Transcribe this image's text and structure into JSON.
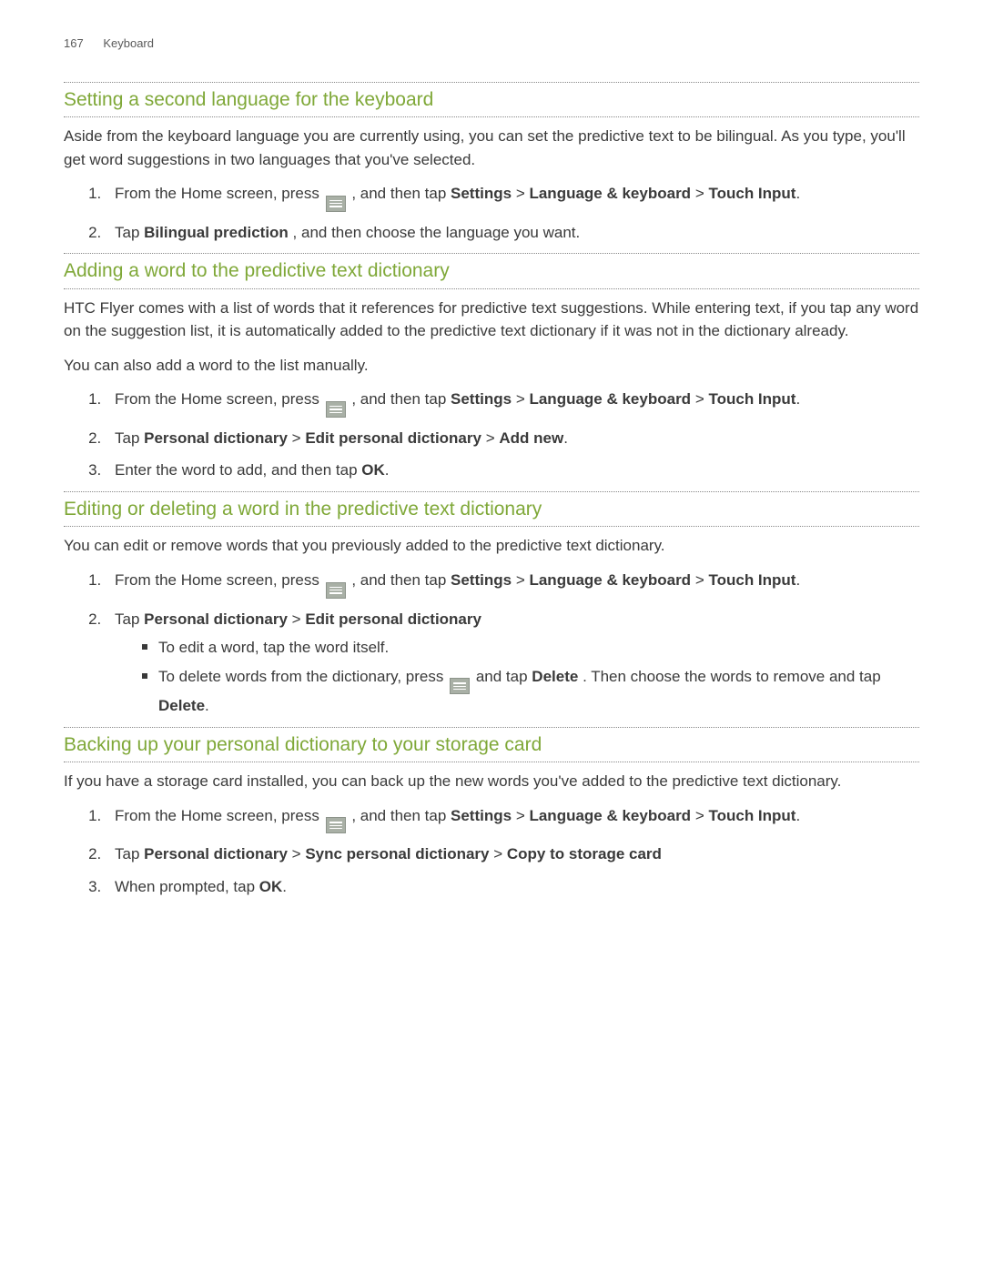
{
  "header": {
    "page_number": "167",
    "section_name": "Keyboard"
  },
  "s1": {
    "heading": "Setting a second language for the keyboard",
    "intro": "Aside from the keyboard language you are currently using, you can set the predictive text to be bilingual. As you type, you'll get word suggestions in two languages that you've selected.",
    "step1_a": "From the Home screen, press ",
    "step1_b": ", and then tap ",
    "settings": "Settings",
    "gt": " > ",
    "lang_kbd": "Language & keyboard",
    "touch_input": "Touch Input",
    "step2_a": "Tap ",
    "bilingual": "Bilingual prediction",
    "step2_b": ", and then choose the language you want."
  },
  "s2": {
    "heading": "Adding a word to the predictive text dictionary",
    "intro": "HTC Flyer comes with a list of words that it references for predictive text suggestions. While entering text, if you tap any word on the suggestion list, it is automatically added to the predictive text dictionary if it was not in the dictionary already.",
    "intro2": "You can also add a word to the list manually.",
    "step1_a": "From the Home screen, press ",
    "step1_b": ", and then tap ",
    "settings": "Settings",
    "gt": " > ",
    "lang_kbd": "Language & keyboard",
    "touch_input": "Touch Input",
    "step2_a": "Tap ",
    "personal_dict": "Personal dictionary",
    "edit_personal": "Edit personal dictionary",
    "add_new": "Add new",
    "step3_a": "Enter the word to add, and then tap ",
    "ok": "OK",
    "period": "."
  },
  "s3": {
    "heading": "Editing or deleting a word in the predictive text dictionary",
    "intro": "You can edit or remove words that you previously added to the predictive text dictionary.",
    "step1_a": "From the Home screen, press ",
    "step1_b": ", and then tap ",
    "settings": "Settings",
    "gt": " > ",
    "lang_kbd": "Language & keyboard",
    "touch_input": "Touch Input",
    "step2_a": "Tap ",
    "personal_dict": "Personal dictionary",
    "edit_personal": "Edit personal dictionary",
    "bullet1": "To edit a word, tap the word itself.",
    "bullet2_a": "To delete words from the dictionary, press ",
    "bullet2_b": " and tap ",
    "delete": "Delete",
    "bullet2_c": ". Then choose the words to remove and tap ",
    "period": "."
  },
  "s4": {
    "heading": "Backing up your personal dictionary to your storage card",
    "intro": "If you have a storage card installed, you can back up the new words you've added to the predictive text dictionary.",
    "step1_a": "From the Home screen, press ",
    "step1_b": ", and then tap ",
    "settings": "Settings",
    "gt": " > ",
    "lang_kbd": "Language & keyboard",
    "touch_input": "Touch Input",
    "step2_a": "Tap ",
    "personal_dict": "Personal dictionary",
    "sync_personal": "Sync personal dictionary",
    "copy_card": "Copy to storage card",
    "step3_a": "When prompted, tap ",
    "ok": "OK",
    "period": "."
  }
}
